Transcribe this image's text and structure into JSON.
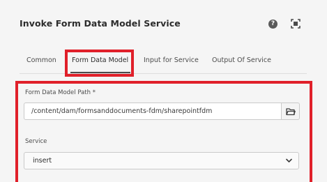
{
  "dialog": {
    "title": "Invoke Form Data Model Service",
    "help_icon_glyph": "?",
    "icons": [
      "help-icon",
      "fullscreen-icon"
    ]
  },
  "tabs": [
    {
      "label": "Common"
    },
    {
      "label": "Form Data Model",
      "selected": true
    },
    {
      "label": "Input for Service"
    },
    {
      "label": "Output Of Service"
    }
  ],
  "form": {
    "path_label": "Form Data Model Path *",
    "path_value": "/content/dam/formsanddocuments-fdm/sharepointfdm",
    "browse_icon": "folder-icon",
    "service_label": "Service",
    "service_value": "insert",
    "service_icon": "chevron-down-icon"
  },
  "colors": {
    "highlight": "#e0202a",
    "text": "#2c2c2c",
    "background": "#f5f5f5"
  }
}
